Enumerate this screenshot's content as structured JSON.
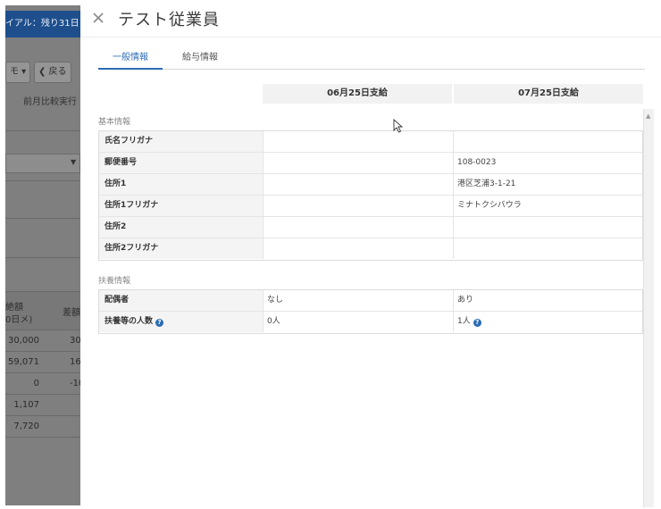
{
  "background": {
    "banner": "イアル：残り31日",
    "memo_button": "モ ▾",
    "back_button": "❮ 戻る",
    "compare_text": "前月比較実行",
    "table_head_1": "絶額",
    "table_head_2": "0日メ)",
    "table_head_3": "差額",
    "rows": [
      {
        "a": "30,000",
        "b": "30"
      },
      {
        "a": "59,071",
        "b": "16"
      },
      {
        "a": "0",
        "b": "-10"
      },
      {
        "a": "1,107",
        "b": ""
      },
      {
        "a": "7,720",
        "b": ""
      }
    ]
  },
  "panel": {
    "title": "テスト従業員",
    "tabs": [
      {
        "label": "一般情報"
      },
      {
        "label": "給与情報"
      }
    ],
    "columns": [
      "06月25日支給",
      "07月25日支給"
    ],
    "sections": [
      {
        "label": "基本情報",
        "rows": [
          {
            "label": "氏名フリガナ",
            "v1": "",
            "v2": ""
          },
          {
            "label": "郵便番号",
            "v1": "",
            "v2": "108-0023"
          },
          {
            "label": "住所1",
            "v1": "",
            "v2": "港区芝浦3-1-21"
          },
          {
            "label": "住所1フリガナ",
            "v1": "",
            "v2": "ミナトクシバウラ"
          },
          {
            "label": "住所2",
            "v1": "",
            "v2": ""
          },
          {
            "label": "住所2フリガナ",
            "v1": "",
            "v2": ""
          }
        ]
      },
      {
        "label": "扶養情報",
        "rows": [
          {
            "label": "配偶者",
            "v1": "なし",
            "v2": "あり"
          },
          {
            "label": "扶養等の人数",
            "v1": "0人",
            "v2": "1人"
          }
        ]
      }
    ],
    "help_glyph": "?"
  },
  "colors": {
    "accent": "#2b6cb3",
    "overlay": "#7f7f7f",
    "banner": "#1e4f8c"
  }
}
